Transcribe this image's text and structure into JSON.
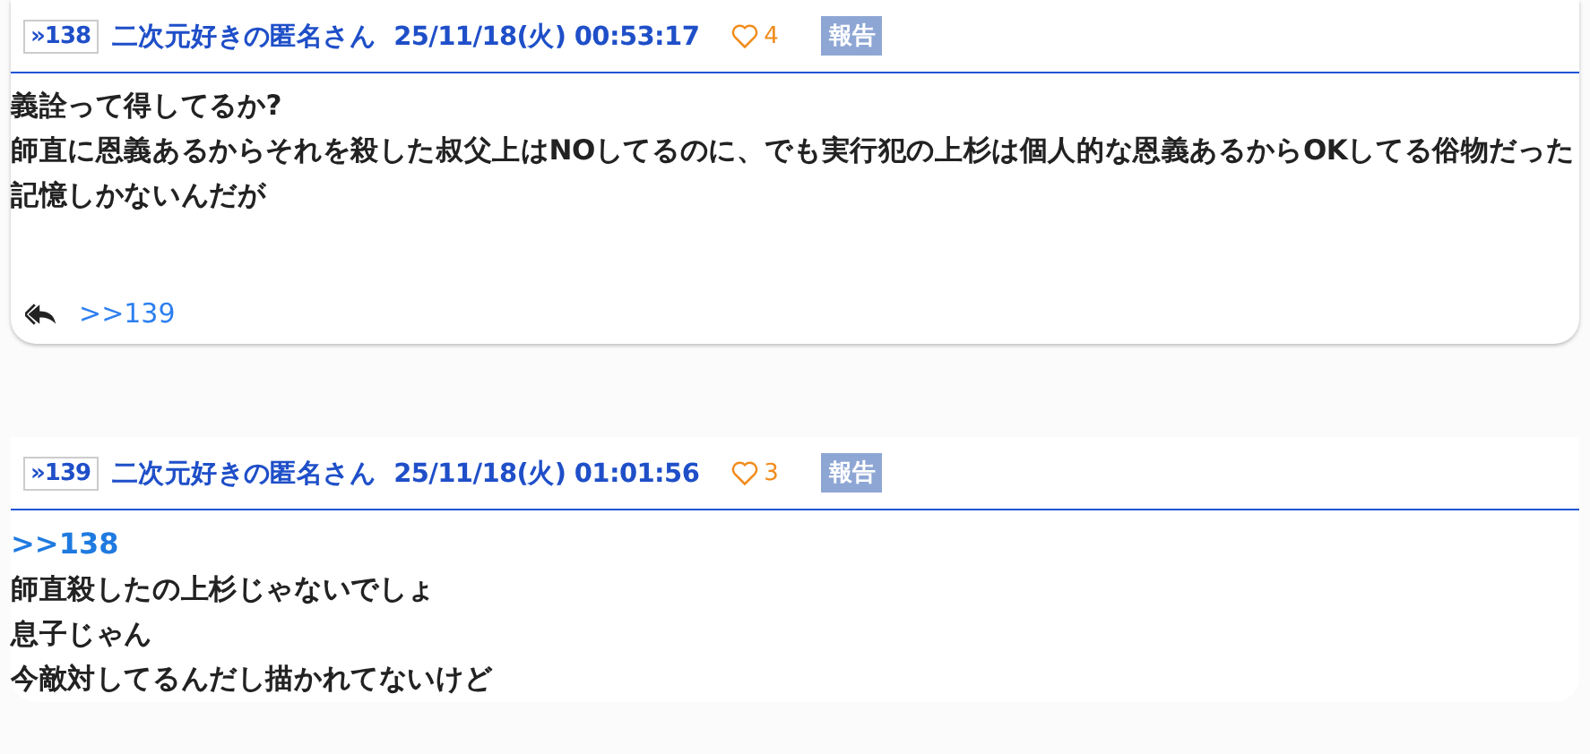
{
  "posts": [
    {
      "number": "»138",
      "name": "二次元好きの匿名さん",
      "date": "25/11/18(火) 00:53:17",
      "likes": "4",
      "report": "報告",
      "body": [
        "義詮って得してるか?",
        "師直に恩義あるからそれを殺した叔父上はNOしてるのに、でも実行犯の上杉は個人的な恩義あるからOKしてる俗物だった記憶しかないんだが"
      ],
      "replies": [
        ">>139"
      ]
    },
    {
      "number": "»139",
      "name": "二次元好きの匿名さん",
      "date": "25/11/18(火) 01:01:56",
      "likes": "3",
      "report": "報告",
      "quote": ">>138",
      "body": [
        "師直殺したの上杉じゃないでしょ",
        "息子じゃん",
        "今敵対してるんだし描かれてないけど"
      ]
    }
  ]
}
